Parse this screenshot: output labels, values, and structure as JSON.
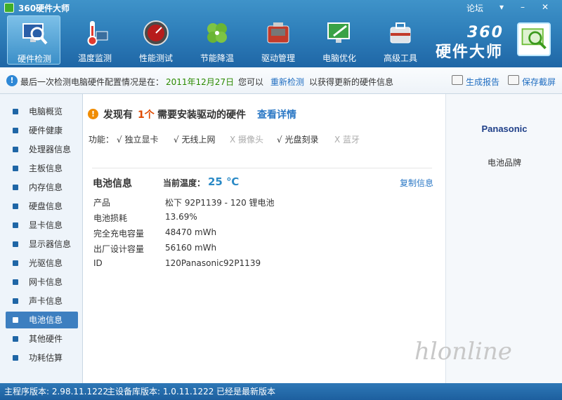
{
  "app": {
    "title": "360硬件大师",
    "forum_link": "论坛",
    "menu_icon": "chevron-down-icon",
    "min_icon": "minimize-icon",
    "close_icon": "close-icon"
  },
  "nav": {
    "items": [
      {
        "label": "硬件检测",
        "icon": "monitor-magnifier-icon",
        "active": true
      },
      {
        "label": "温度监测",
        "icon": "thermometer-icon"
      },
      {
        "label": "性能测试",
        "icon": "speedometer-icon"
      },
      {
        "label": "节能降温",
        "icon": "clover-fan-icon"
      },
      {
        "label": "驱动管理",
        "icon": "toolbox-icon"
      },
      {
        "label": "电脑优化",
        "icon": "monitor-broom-icon"
      },
      {
        "label": "高级工具",
        "icon": "toolkit-icon"
      }
    ],
    "brand_num": "360",
    "brand_name": "硬件大师"
  },
  "infobar": {
    "prefix": "最后一次检测电脑硬件配置情况是在：",
    "date": "2011年12月27日",
    "middle": "您可以",
    "recheck_link": "重新检测",
    "suffix": "以获得更新的硬件信息",
    "report_label": "生成报告",
    "save_label": "保存截屏"
  },
  "sidebar": {
    "items": [
      {
        "label": "电脑概览"
      },
      {
        "label": "硬件健康"
      },
      {
        "label": "处理器信息"
      },
      {
        "label": "主板信息"
      },
      {
        "label": "内存信息"
      },
      {
        "label": "硬盘信息"
      },
      {
        "label": "显卡信息"
      },
      {
        "label": "显示器信息"
      },
      {
        "label": "光驱信息"
      },
      {
        "label": "网卡信息"
      },
      {
        "label": "声卡信息"
      },
      {
        "label": "电池信息",
        "active": true
      },
      {
        "label": "其他硬件"
      },
      {
        "label": "功耗估算"
      }
    ]
  },
  "main": {
    "warning_prefix": "发现有",
    "warning_count": "1个",
    "warning_suffix": "需要安装驱动的硬件",
    "warning_link": "查看详情",
    "features_label": "功能：",
    "features": [
      {
        "text": "√ 独立显卡",
        "enabled": true
      },
      {
        "text": "√ 无线上网",
        "enabled": true
      },
      {
        "text": "X 摄像头",
        "enabled": false
      },
      {
        "text": "√ 光盘刻录",
        "enabled": true
      },
      {
        "text": "X 蓝牙",
        "enabled": false
      }
    ],
    "battery": {
      "title": "电池信息",
      "temp_label": "当前温度：",
      "temp_value": "25 ℃",
      "copy_link": "复制信息",
      "rows": [
        {
          "label": "产品",
          "value": "松下 92P1139 -   120 锂电池"
        },
        {
          "label": "电池损耗",
          "value": "13.69%"
        },
        {
          "label": "完全充电容量",
          "value": "48470 mWh"
        },
        {
          "label": "出厂设计容量",
          "value": "56160 mWh"
        },
        {
          "label": "ID",
          "value": "120Panasonic92P1139"
        }
      ]
    }
  },
  "rightpanel": {
    "brand_logo": "Panasonic",
    "brand_caption": "电池品牌",
    "watermark": "hlonline"
  },
  "statusbar": {
    "program_version": "主程序版本: 2.98.11.1222",
    "db_version": "主设备库版本: 1.0.11.1222",
    "latest": "已经是最新版本"
  }
}
